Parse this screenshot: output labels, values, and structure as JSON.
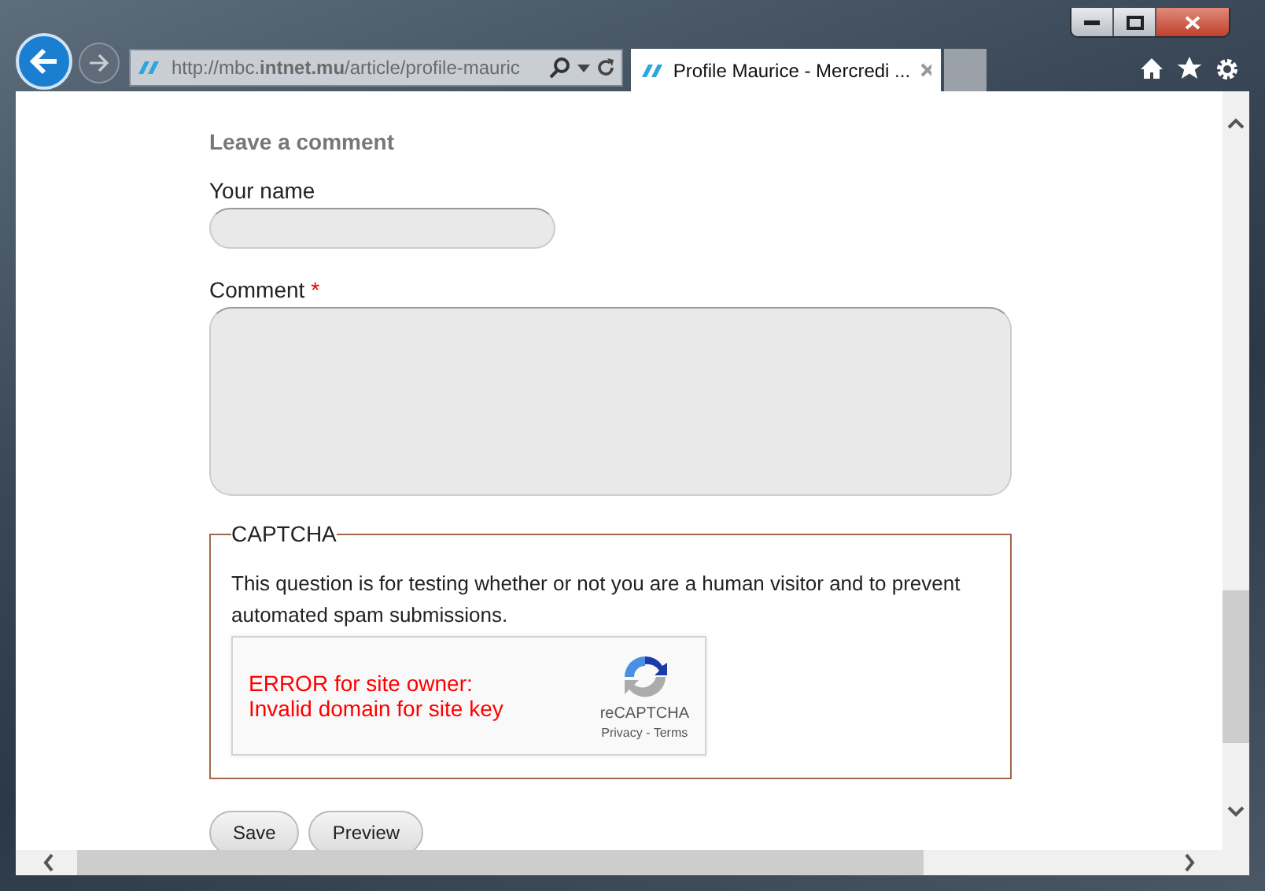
{
  "browser": {
    "address": "http://mbc.**intnet.mu**/article/profile-mauric",
    "tab_title": "Profile Maurice - Mercredi ..."
  },
  "form": {
    "heading": "Leave a comment",
    "name_field": {
      "label": "Your name"
    },
    "comment_field": {
      "label": "Comment",
      "required_mark": "*"
    },
    "captcha": {
      "legend": "CAPTCHA",
      "description": "This question is for testing whether or not you are a human visitor and to prevent automated spam submissions.",
      "error_lines": [
        "ERROR for site owner:",
        "Invalid domain for site key"
      ],
      "brand": "reCAPTCHA",
      "privacy": "Privacy",
      "separator": " - ",
      "terms": "Terms"
    },
    "buttons": [
      "Save",
      "Preview"
    ]
  }
}
